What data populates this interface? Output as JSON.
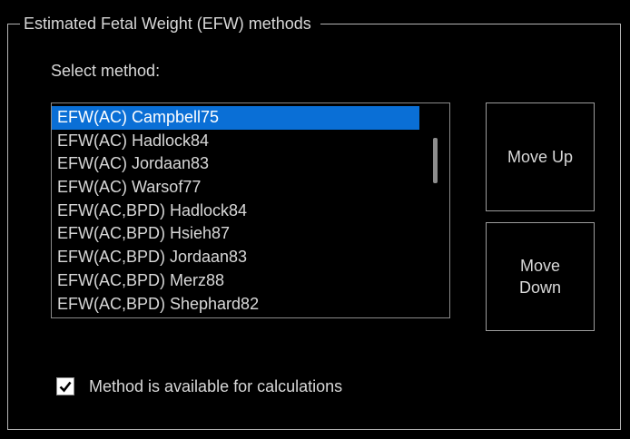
{
  "group": {
    "title": "Estimated Fetal Weight (EFW) methods"
  },
  "select_label": "Select method:",
  "methods": {
    "selected_index": 0,
    "items": [
      "EFW(AC) Campbell75",
      "EFW(AC) Hadlock84",
      "EFW(AC) Jordaan83",
      "EFW(AC) Warsof77",
      "EFW(AC,BPD) Hadlock84",
      "EFW(AC,BPD) Hsieh87",
      "EFW(AC,BPD) Jordaan83",
      "EFW(AC,BPD) Merz88",
      "EFW(AC,BPD) Shephard82"
    ]
  },
  "buttons": {
    "move_up": "Move Up",
    "move_down": "Move\nDown"
  },
  "checkbox": {
    "label": "Method is available for calculations",
    "checked": true
  },
  "colors": {
    "background": "#000000",
    "text": "#d8d8d8",
    "selection": "#0a6fd6",
    "border": "#9c9c9c"
  }
}
